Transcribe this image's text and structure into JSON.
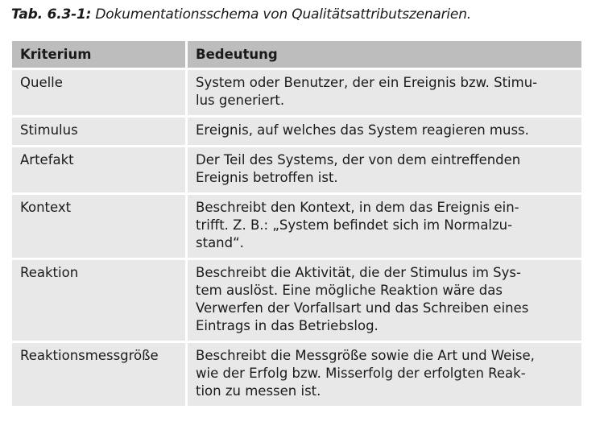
{
  "caption": {
    "label": "Tab. 6.3-1:",
    "text": " Dokumentationsschema von Qualitätsattributszenarien."
  },
  "table": {
    "headers": [
      "Kriterium",
      "Bedeutung"
    ],
    "rows": [
      {
        "kriterium": "Quelle",
        "bedeutung": [
          "System oder Benutzer, der ein Ereignis bzw. Stimu-",
          "lus generiert."
        ]
      },
      {
        "kriterium": "Stimulus",
        "bedeutung": [
          "Ereignis, auf welches das System reagieren muss."
        ]
      },
      {
        "kriterium": "Artefakt",
        "bedeutung": [
          "Der Teil des Systems, der von dem eintreffenden",
          "Ereignis betroffen ist."
        ]
      },
      {
        "kriterium": "Kontext",
        "bedeutung": [
          "Beschreibt den Kontext, in dem das Ereignis ein-",
          "trifft. Z. B.: „System befindet sich im Normalzu-",
          "stand“."
        ]
      },
      {
        "kriterium": "Reaktion",
        "bedeutung": [
          "Beschreibt die Aktivität, die der Stimulus im Sys-",
          "tem auslöst. Eine mögliche Reaktion wäre das",
          "Verwerfen der Vorfallsart und das Schreiben eines",
          "Eintrags in das Betriebslog."
        ]
      },
      {
        "kriterium": "Reaktionsmessgröße",
        "bedeutung": [
          "Beschreibt die Messgröße sowie die Art und Weise,",
          "wie der Erfolg bzw. Misserfolg der erfolgten Reak-",
          "tion zu messen ist."
        ]
      }
    ]
  }
}
